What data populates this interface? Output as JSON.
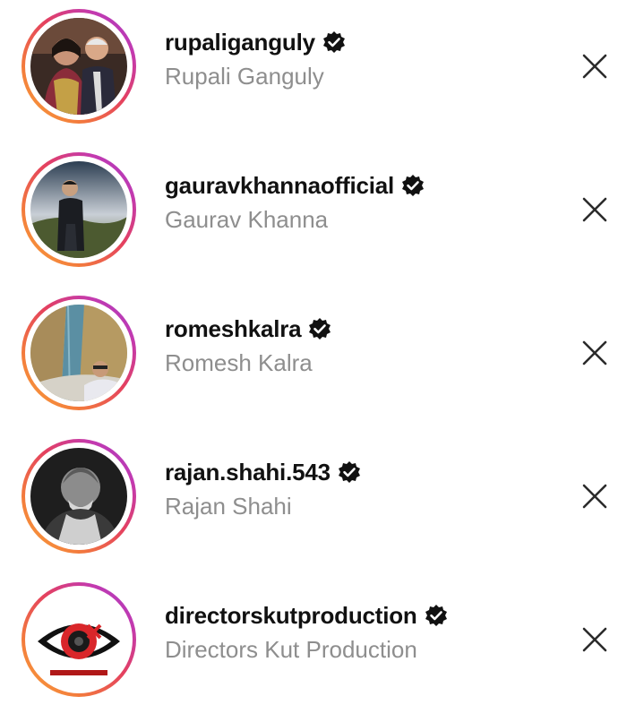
{
  "suggestions": [
    {
      "username": "rupaliganguly",
      "full_name": "Rupali Ganguly",
      "verified": true
    },
    {
      "username": "gauravkhannaofficial",
      "full_name": "Gaurav Khanna",
      "verified": true
    },
    {
      "username": "romeshkalra",
      "full_name": "Romesh Kalra",
      "verified": true
    },
    {
      "username": "rajan.shahi.543",
      "full_name": "Rajan Shahi",
      "verified": true
    },
    {
      "username": "directorskutproduction",
      "full_name": "Directors Kut Production",
      "verified": true
    }
  ],
  "icons": {
    "verified": "verified-badge-icon",
    "dismiss": "close-icon"
  },
  "colors": {
    "username": "#111111",
    "full_name": "#8e8e8e",
    "story_ring_start": "#f9a43a",
    "story_ring_end": "#9b3dc9"
  }
}
